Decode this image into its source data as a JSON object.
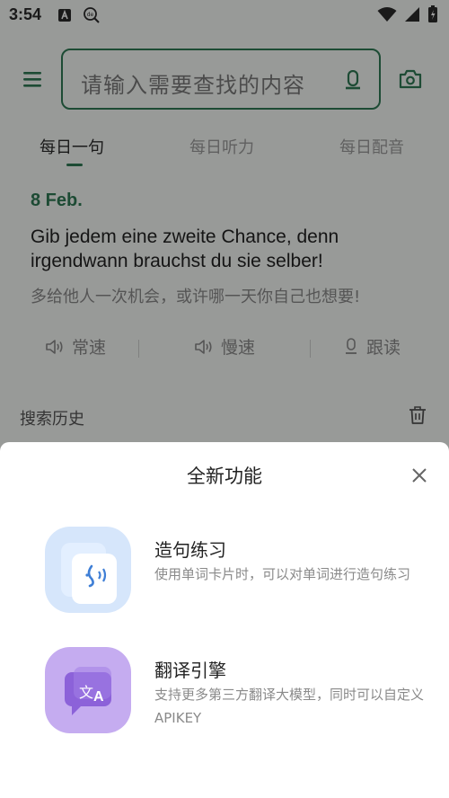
{
  "status_bar": {
    "time": "3:54"
  },
  "search": {
    "placeholder": "请输入需要查找的内容"
  },
  "tabs": [
    {
      "label": "每日一句",
      "active": true
    },
    {
      "label": "每日听力",
      "active": false
    },
    {
      "label": "每日配音",
      "active": false
    }
  ],
  "daily": {
    "date": "8 Feb.",
    "sentence": "Gib jedem eine zweite Chance, denn irgendwann brauchst du sie selber!",
    "translation": "多给他人一次机会，或许哪一天你自己也想要!",
    "actions": [
      {
        "label": "常速",
        "icon": "speaker-icon"
      },
      {
        "label": "慢速",
        "icon": "speaker-icon"
      },
      {
        "label": "跟读",
        "icon": "mic-icon"
      }
    ]
  },
  "history": {
    "label": "搜索历史"
  },
  "sheet": {
    "title": "全新功能",
    "features": [
      {
        "title": "造句练习",
        "desc": "使用单词卡片时，可以对单词进行造句练习",
        "icon": "sentence-practice-icon",
        "color": "#cfe3fb"
      },
      {
        "title": "翻译引擎",
        "desc": "支持更多第三方翻译大模型，同时可以自定义APIKEY",
        "icon": "translate-icon",
        "color": "#c9b2f1"
      }
    ]
  },
  "colors": {
    "accent": "#2f7a55",
    "overlay": "rgba(0,0,0,0.38)"
  }
}
